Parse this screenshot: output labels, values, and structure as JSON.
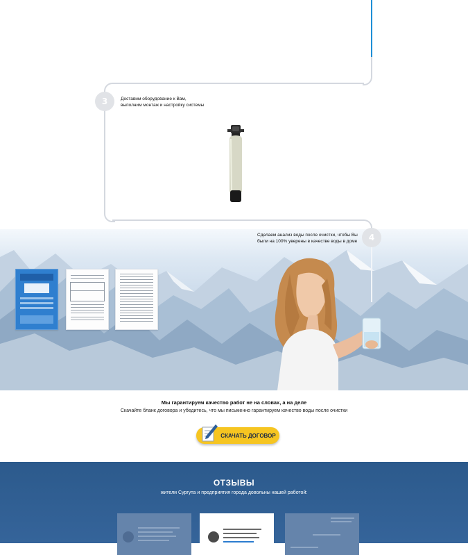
{
  "steps": {
    "step3": {
      "number": "3",
      "text_line1": "Доставим оборудование к Вам,",
      "text_line2": "выполним монтаж и настройку системы"
    },
    "step4": {
      "number": "4",
      "text_line1": "Сделаем анализ воды после очистки, чтобы Вы",
      "text_line2": "были на 100% уверены в качестве воды в доме"
    }
  },
  "guarantee": {
    "title": "Мы гарантируем качество работ не на словах, а на деле",
    "subtitle": "Скачайте бланк договора и убедитесь, что мы письменно гарантируем качество воды после очистки"
  },
  "download_button": {
    "label": "СКАЧАТЬ ДОГОВОР"
  },
  "reviews": {
    "title": "ОТЗЫВЫ",
    "subtitle": "жители Сургута и предприятия города довольны нашей работой:"
  },
  "colors": {
    "accent_blue": "#1e8fd6",
    "button_yellow": "#f6c521",
    "reviews_bg": "#2e5d90",
    "step_gray": "#e1e3e7"
  }
}
